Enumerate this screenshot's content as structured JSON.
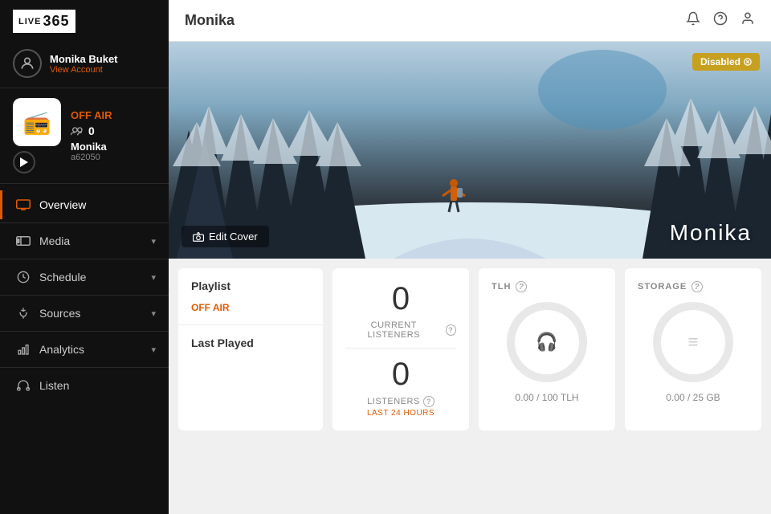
{
  "sidebar": {
    "logo": {
      "live": "LIVE",
      "number": "365"
    },
    "account": {
      "name": "Monika Buket",
      "view_account_label": "View Account"
    },
    "station": {
      "status": "OFF AIR",
      "listener_count": "0",
      "name": "Monika",
      "code": "a62050"
    },
    "nav": [
      {
        "id": "overview",
        "label": "Overview",
        "icon": "monitor",
        "active": true,
        "has_chevron": false
      },
      {
        "id": "media",
        "label": "Media",
        "icon": "media",
        "active": false,
        "has_chevron": true
      },
      {
        "id": "schedule",
        "label": "Schedule",
        "icon": "clock",
        "active": false,
        "has_chevron": true
      },
      {
        "id": "sources",
        "label": "Sources",
        "icon": "plug",
        "active": false,
        "has_chevron": true
      },
      {
        "id": "analytics",
        "label": "Analytics",
        "icon": "chart",
        "active": false,
        "has_chevron": true
      },
      {
        "id": "listen",
        "label": "Listen",
        "icon": "headphone",
        "active": false,
        "has_chevron": false
      }
    ]
  },
  "topbar": {
    "title": "Monika",
    "bell_label": "notifications",
    "help_label": "help",
    "account_label": "account"
  },
  "cover": {
    "edit_button_label": "Edit Cover",
    "station_name": "Monika",
    "disabled_badge": "Disabled"
  },
  "stats": {
    "playlist": {
      "title": "Playlist",
      "status": "OFF AIR"
    },
    "last_played": {
      "title": "Last Played"
    },
    "listeners": {
      "current_value": "0",
      "current_label": "CURRENT LISTENERS",
      "last24_value": "0",
      "last24_label": "LISTENERS",
      "last24_sublabel": "LAST 24 HOURS"
    },
    "tlh": {
      "header": "TLH",
      "value_label": "0.00 / 100 TLH"
    },
    "storage": {
      "header": "STORAGE",
      "value_label": "0.00 / 25 GB"
    }
  }
}
